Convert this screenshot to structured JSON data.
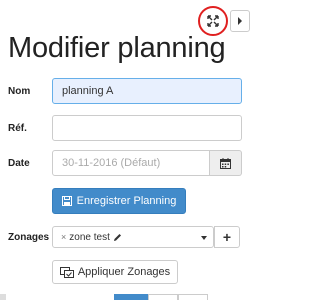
{
  "header": {
    "title": "Modifier planning"
  },
  "form": {
    "nom": {
      "label": "Nom",
      "value": "planning A"
    },
    "ref": {
      "label": "Réf.",
      "value": ""
    },
    "date": {
      "label": "Date",
      "placeholder": "30-11-2016 (Défaut)"
    },
    "save_label": "Enregistrer Planning",
    "zonages": {
      "label": "Zonages",
      "tag": "zone test"
    },
    "apply_label": "Appliquer Zonages"
  },
  "icons": {
    "expand": "expand-arrows-icon",
    "collapse": "caret-right-icon",
    "calendar": "calendar-icon",
    "save": "floppy-disk-icon",
    "edit": "pencil-icon",
    "apply": "apply-zones-icon"
  },
  "colors": {
    "primary": "#428bca",
    "highlight_ring": "#e02020",
    "focused_field": "#e8f0fe"
  }
}
